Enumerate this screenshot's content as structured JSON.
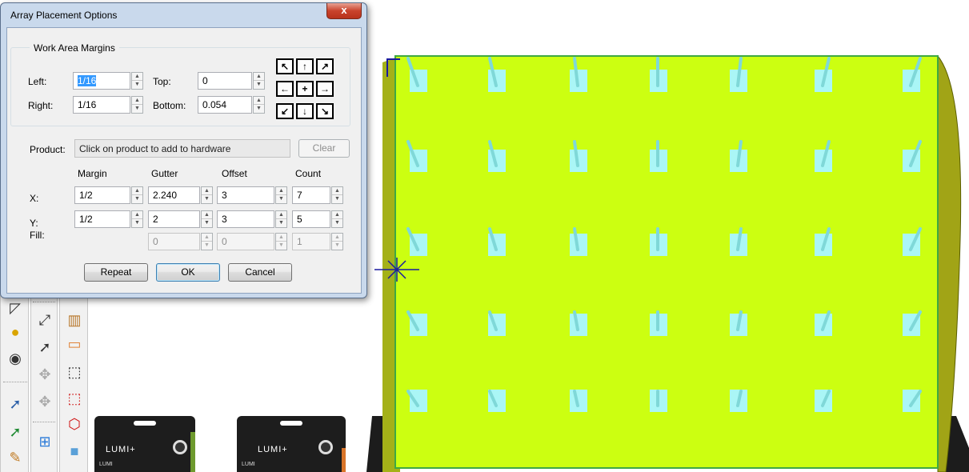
{
  "dialog": {
    "title": "Array Placement Options",
    "close_glyph": "x",
    "work_area_margins": {
      "legend": "Work Area Margins",
      "left_label": "Left:",
      "left_value": "1/16",
      "right_label": "Right:",
      "right_value": "1/16",
      "top_label": "Top:",
      "top_value": "0",
      "bottom_label": "Bottom:",
      "bottom_value": "0.054"
    },
    "alignment_arrows": [
      "↖",
      "↑",
      "↗",
      "←",
      "+",
      "→",
      "↙",
      "↓",
      "↘"
    ],
    "product": {
      "label": "Product:",
      "value": "Click on product to add to hardware",
      "clear_label": "Clear"
    },
    "grid": {
      "columns": [
        "Margin",
        "Gutter",
        "Offset",
        "Count"
      ],
      "rows": [
        {
          "label": "X:",
          "values": [
            "1/2",
            "2.240",
            "3",
            "7"
          ],
          "enabled": true
        },
        {
          "label": "Y:",
          "values": [
            "1/2",
            "2",
            "3",
            "5"
          ],
          "enabled": true
        },
        {
          "label": "Fill:",
          "values": [
            "",
            "0",
            "0",
            "1"
          ],
          "enabled": false
        }
      ]
    },
    "buttons": {
      "repeat": "Repeat",
      "ok": "OK",
      "cancel": "Cancel"
    }
  },
  "scene": {
    "board_color": "#ccff11",
    "hook_color": "#aaf6f6",
    "hook_rows": 5,
    "hook_columns": 7,
    "packages": [
      {
        "brand": "LUMI+",
        "tag": "LUMI"
      },
      {
        "brand": "LUMI+",
        "tag": "LUMI"
      }
    ]
  },
  "colors": {
    "dialog_frame": "#c9d9ec",
    "close_button": "#c9432c",
    "selection": "#3399ff"
  }
}
